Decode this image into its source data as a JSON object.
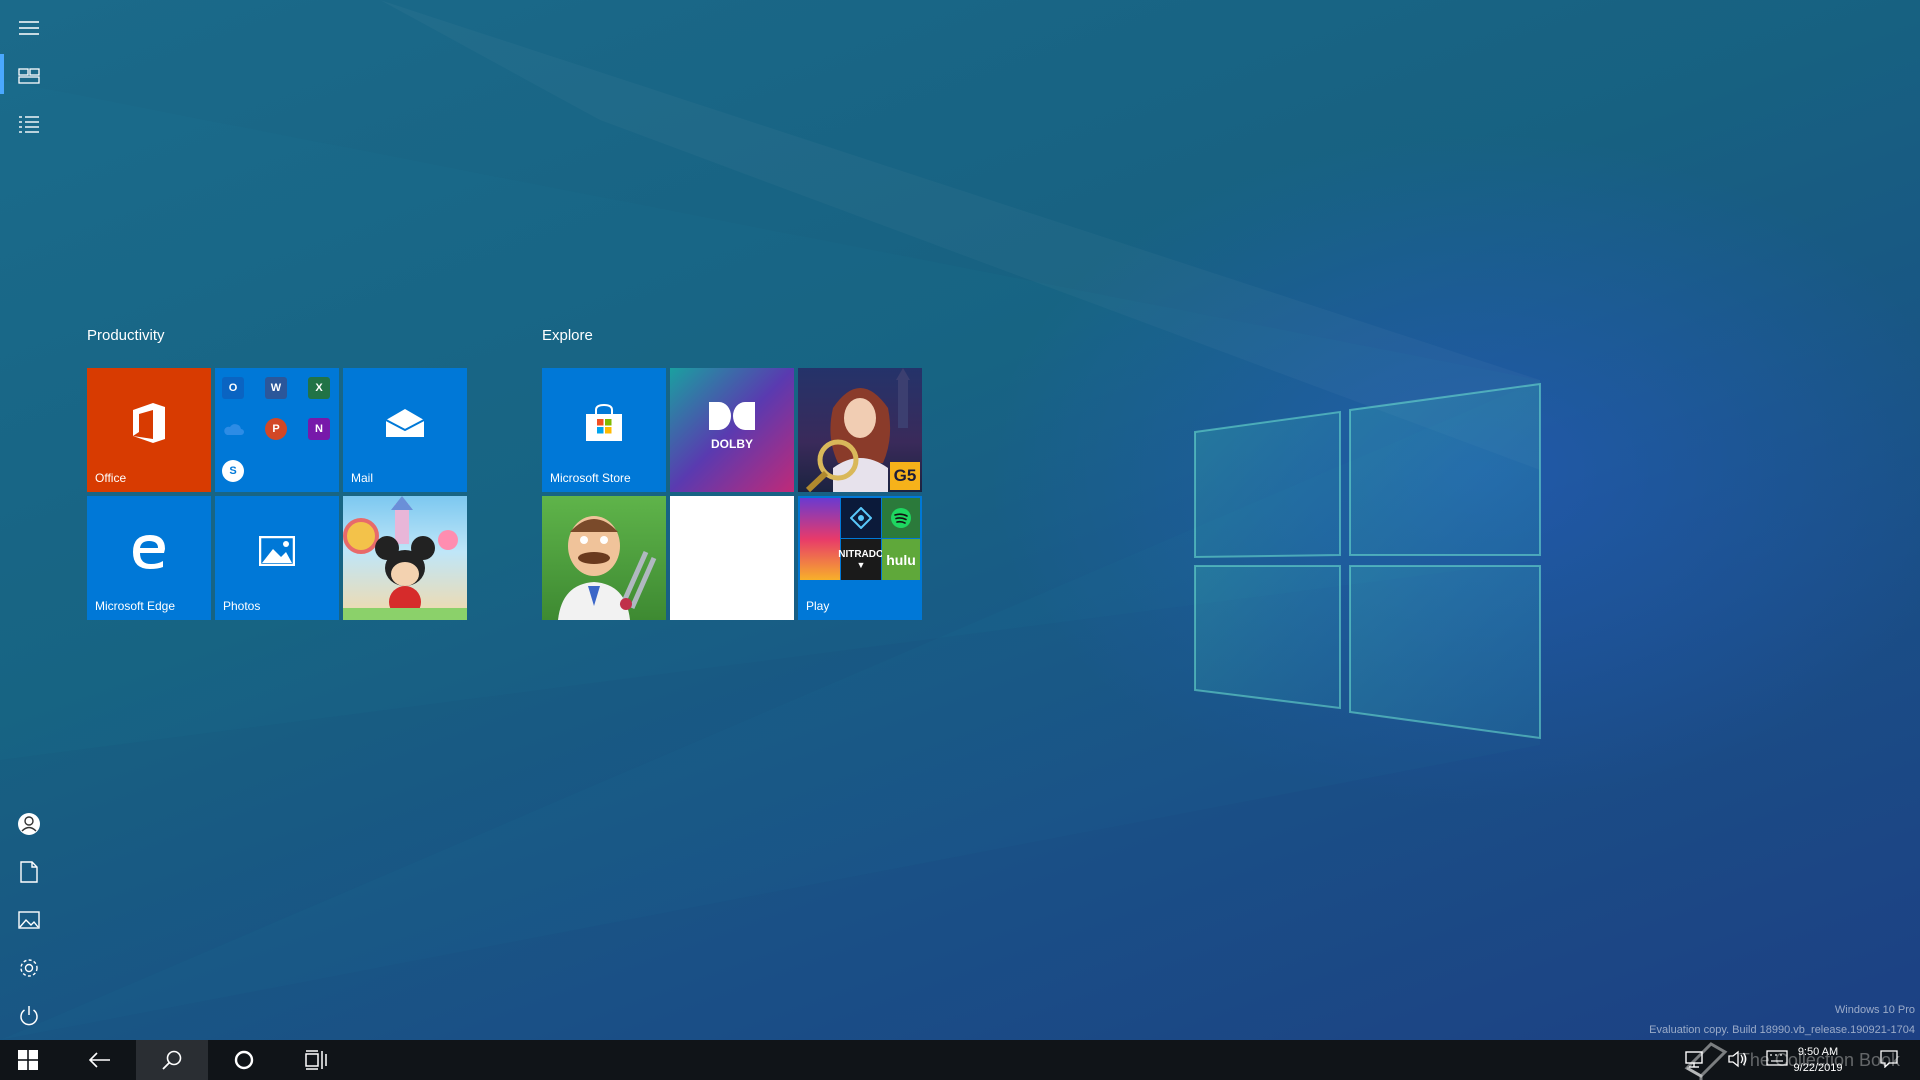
{
  "start": {
    "groups": [
      {
        "title": "Productivity",
        "tiles": [
          {
            "label": "Office",
            "color": "#d83b01"
          },
          {
            "label": "",
            "color": "#0078d7",
            "mini_apps": [
              "Outlook",
              "Word",
              "Excel",
              "OneDrive",
              "PowerPoint",
              "OneNote",
              "Skype"
            ]
          },
          {
            "label": "Mail",
            "color": "#0078d7"
          },
          {
            "label": "Microsoft Edge",
            "color": "#0078d7"
          },
          {
            "label": "Photos",
            "color": "#0078d7"
          },
          {
            "label": "",
            "color": "#62b8e8",
            "art": "mickey-game"
          }
        ]
      },
      {
        "title": "Explore",
        "tiles": [
          {
            "label": "Microsoft Store",
            "color": "#0078d7"
          },
          {
            "label": "",
            "color": "#6a2aa6",
            "art": "dolby",
            "logo_text": "DOLBY"
          },
          {
            "label": "",
            "color": "#1d2b55",
            "art": "hidden-object-game",
            "badge_text": "G5"
          },
          {
            "label": "",
            "color": "#4f9e3a",
            "art": "gardenscapes"
          },
          {
            "label": "",
            "color": "#ffffff",
            "art": "audio-wave"
          },
          {
            "label": "Play",
            "color": "#0078d7",
            "mini_apps": [
              "Candy Crush Friends",
              "Photoshop Express",
              "Spotify",
              "Nitrado",
              "Hulu"
            ],
            "nitrado_text": "NITRADO",
            "hulu_text": "hulu"
          }
        ]
      }
    ],
    "rail": {
      "top": [
        "hamburger-icon",
        "tiles-view-icon",
        "all-apps-list-icon"
      ],
      "bottom": [
        "user-icon",
        "documents-icon",
        "pictures-icon",
        "settings-icon",
        "power-icon"
      ]
    }
  },
  "watermark": {
    "line1": "Windows 10 Pro",
    "line2": "Evaluation copy. Build 18990.vb_release.190921-1704",
    "overlay": "The Collection Book"
  },
  "taskbar": {
    "buttons": [
      "start-icon",
      "back-icon",
      "search-icon",
      "cortana-icon",
      "task-view-icon"
    ],
    "time": "9:50 AM",
    "date": "9/22/2019"
  }
}
